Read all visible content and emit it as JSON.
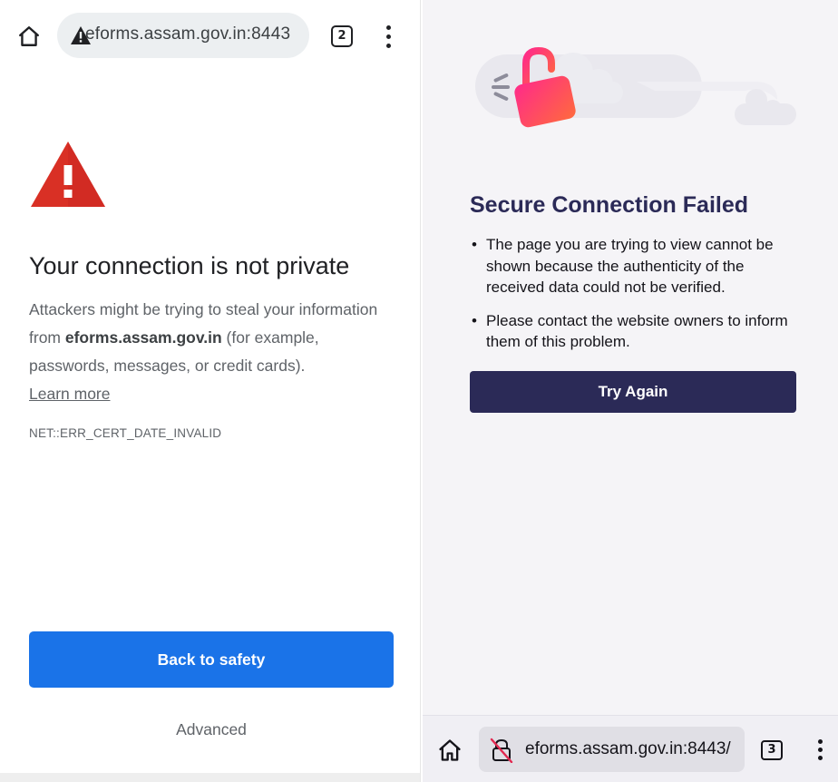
{
  "left_browser": {
    "url": "eforms.assam.gov.in:8443",
    "tab_count": "2",
    "title": "Your connection is not private",
    "body_before": "Attackers might be trying to steal your information from ",
    "body_domain": "eforms.assam.gov.in",
    "body_after": " (for example, passwords, messages, or credit cards).",
    "learn_more": "Learn more",
    "error_code": "NET::ERR_CERT_DATE_INVALID",
    "back_button": "Back to safety",
    "advanced_button": "Advanced",
    "icons": [
      "home-icon",
      "warning-icon",
      "more-vert-icon",
      "error-triangle-icon"
    ],
    "colors": {
      "primary_button": "#1a73e8",
      "warning_red": "#d93025"
    }
  },
  "right_browser": {
    "title": "Secure Connection Failed",
    "bullets": [
      "The page you are trying to view cannot be shown because the authenticity of the received data could not be verified.",
      "Please contact the website owners to inform them of this problem."
    ],
    "try_again_button": "Try Again",
    "url": "eforms.assam.gov.in:8443/",
    "tab_count": "3",
    "icons": [
      "broken-lock-illustration",
      "home-icon",
      "insecure-lock-icon",
      "more-vert-icon"
    ],
    "colors": {
      "primary_button": "#2b2a57",
      "title": "#2b2a57",
      "lock_gradient_start": "#ff2a8a",
      "lock_gradient_end": "#ff6a3d"
    }
  }
}
